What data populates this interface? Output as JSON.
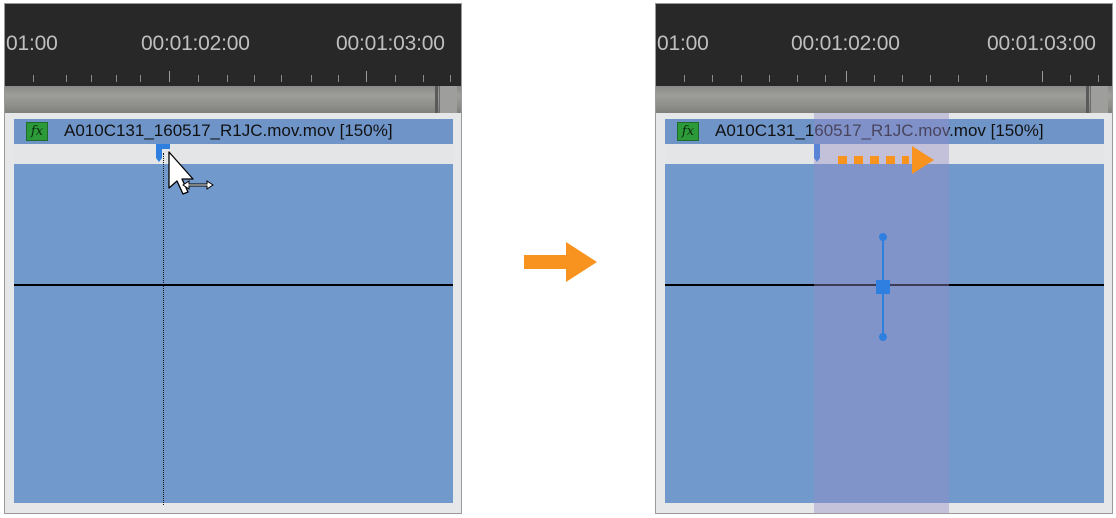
{
  "left_panel": {
    "timecodes": [
      "01:00",
      "00:01:02:00",
      "00:01:03:00"
    ],
    "clip_name": "A010C131_160517_R1JC.mov.mov [150%]",
    "fx_label": "fx",
    "cursor_icon": "arrow-with-horizontal-resize-cursor"
  },
  "right_panel": {
    "timecodes": [
      "01:00",
      "00:01:02:00",
      "00:01:03:00"
    ],
    "clip_name": "A010C131_160517_R1JC.mov.mov [150%]",
    "fx_label": "fx",
    "drag_direction_icon": "dotted-orange-right-arrow"
  },
  "transition_arrow": "orange-right-arrow",
  "colors": {
    "ruler_bg": "#282828",
    "clip_blue": "#7299cc",
    "highlight": "#8b97c6",
    "accent_orange": "#f7931e",
    "keyframe_blue": "#2f7fe0",
    "fx_green": "#2d9a3a"
  }
}
